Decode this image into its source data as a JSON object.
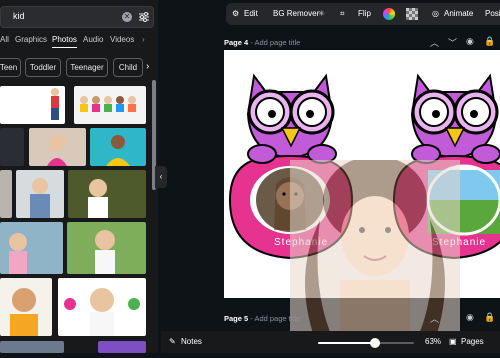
{
  "search": {
    "value": "kid"
  },
  "tabs": [
    "All",
    "Graphics",
    "Photos",
    "Audio",
    "Videos"
  ],
  "active_tab": "Photos",
  "chips": [
    "Teen",
    "Toddler",
    "Teenager",
    "Child"
  ],
  "toolbar": {
    "edit": "Edit",
    "bg_remover": "BG Remover",
    "flip": "Flip",
    "animate": "Animate",
    "position": "Posi"
  },
  "page4": {
    "label": "Page 4",
    "placeholder": "- Add page title"
  },
  "page5": {
    "label": "Page 5",
    "placeholder": "- Add page title"
  },
  "card_names": [
    "Stephanie",
    "Stephanie"
  ],
  "bottom": {
    "notes": "Notes",
    "zoom": "63%",
    "pages": "Pages"
  },
  "zoom_level": 0.63,
  "colors": {
    "accent_purple": "#c25bd8",
    "owl_pink": "#e6338f",
    "owl_beak": "#f5c518",
    "canvas": "#0e1318",
    "panel": "#18191b"
  }
}
